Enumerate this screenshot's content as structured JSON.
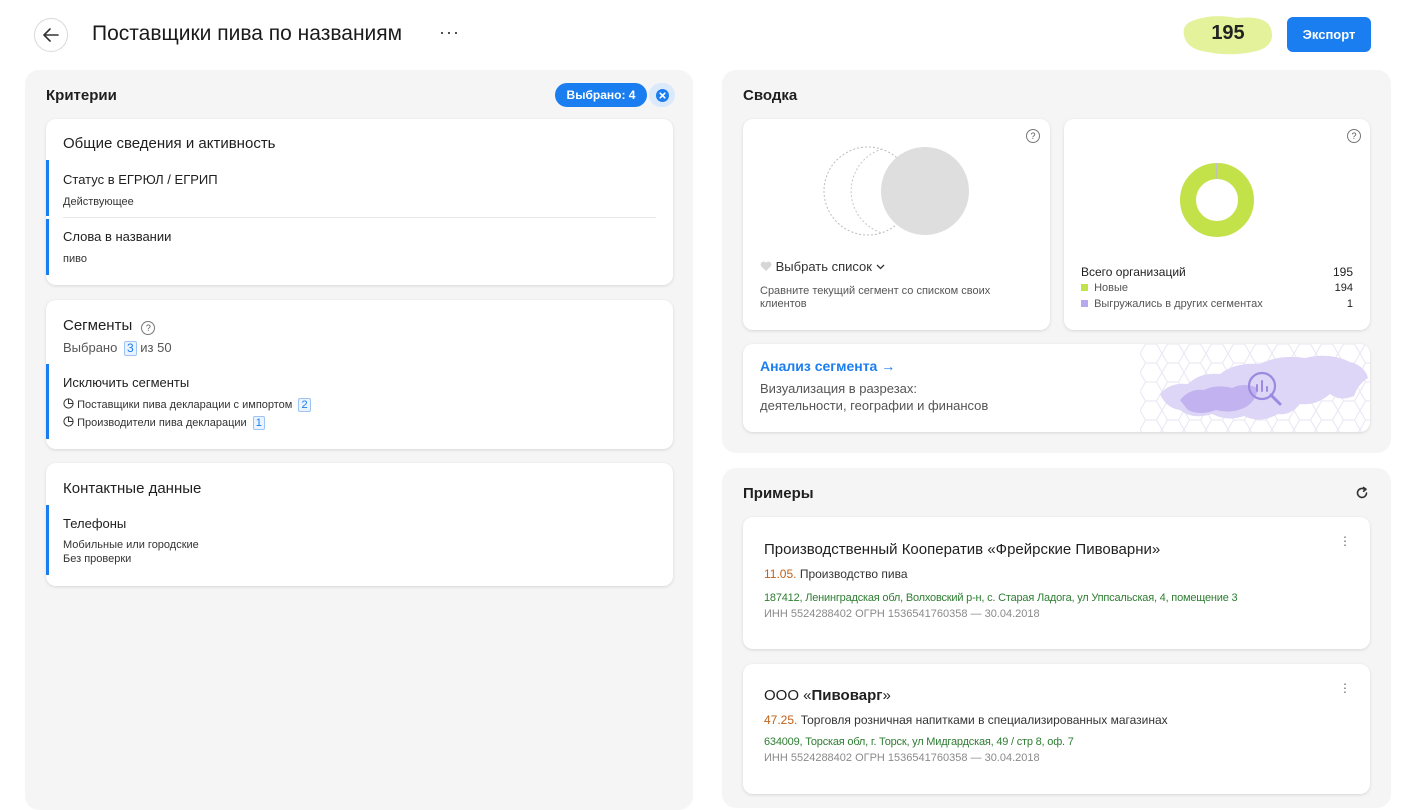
{
  "header": {
    "title": "Поставщики пива по названиям",
    "more": "···",
    "count": "195",
    "export_label": "Экспорт"
  },
  "criteria": {
    "title": "Критерии",
    "selected_chip": "Выбрано: 4",
    "general": {
      "title": "Общие сведения и активность",
      "items": [
        {
          "name": "Статус в ЕГРЮЛ / ЕГРИП",
          "value": "Действующее"
        },
        {
          "name": "Слова в названии",
          "value": "пиво"
        }
      ]
    },
    "segments": {
      "title": "Сегменты",
      "selected_prefix": "Выбрано",
      "selected_count": "3",
      "selected_suffix": "из 50",
      "exclude_title": "Исключить сегменты",
      "items": [
        {
          "name": "Поставщики пива декларации с импортом",
          "count": "2"
        },
        {
          "name": "Производители пива декларации",
          "count": "1"
        }
      ]
    },
    "contacts": {
      "title": "Контактные данные",
      "item_name": "Телефоны",
      "value_line1": "Мобильные или городские",
      "value_line2": "Без проверки"
    }
  },
  "summary": {
    "title": "Сводка",
    "compare": {
      "select_label": "Выбрать список",
      "description": "Сравните текущий сегмент со списком своих клиентов"
    },
    "stats": {
      "total_label": "Всего организаций",
      "total_value": "195",
      "new_label": "Новые",
      "new_value": "194",
      "exported_label": "Выгружались в других сегментах",
      "exported_value": "1",
      "new_share": 0.995,
      "colors": {
        "new": "#c3e24a",
        "exported": "#b6a7ee"
      }
    },
    "analysis": {
      "title": "Анализ сегмента →",
      "line1": "Визуализация в разрезах:",
      "line2": "деятельности, географии и финансов"
    }
  },
  "examples": {
    "title": "Примеры",
    "items": [
      {
        "name": "Производственный Кооператив «Фрейрские Пивоварни»",
        "code": "11.05.",
        "activity": "Производство пива",
        "address": "187412, Ленинградская обл, Волховский р-н, с. Старая Ладога, ул Уппсальская, 4, помещение 3",
        "ids": "ИНН 5524288402    ОГРН 1536541760358 — 30.04.2018"
      },
      {
        "name_prefix": "ООО «",
        "name_bold": "Пивоварг",
        "name_suffix": "»",
        "code": "47.25.",
        "activity": "Торговля розничная напитками в специализированных магазинах",
        "address": "634009, Торская обл, г. Торск, ул Мидгардская, 49 / стр 8, оф. 7",
        "ids": "ИНН 5524288402    ОГРН 1536541760358 — 30.04.2018"
      }
    ]
  }
}
